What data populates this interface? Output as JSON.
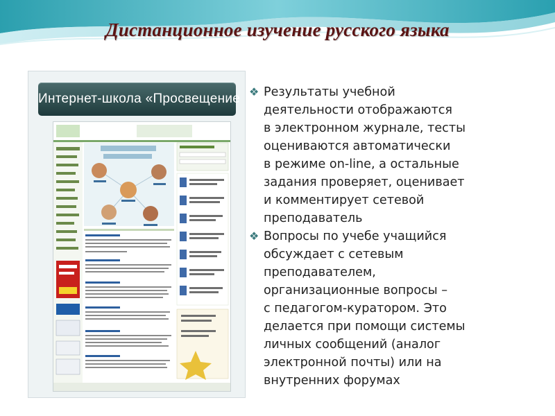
{
  "slide": {
    "title": "Дистанционное изучение русского языка"
  },
  "screenshot": {
    "banner_text": "Интернет-школа «Просвещение"
  },
  "bullets": [
    {
      "text": "Результаты  учебной\nдеятельности отображаются\nв электронном журнале, тесты\nоцениваются автоматически\nв режиме on-line, а остальные\nзадания проверяет, оценивает\nи комментирует сетевой\nпреподаватель"
    },
    {
      "text": "Вопросы по учебе учащийся\nобсуждает с сетевым\nпреподавателем,\nорганизационные вопросы –\nс педагогом-куратором. Это\nделается при помощи системы\nличных сообщений (аналог\nэлектронной почты) или на\nвнутренних форумах"
    }
  ],
  "colors": {
    "title": "#5a1414",
    "bullet": "#3b7a7d",
    "wave_main": "#2fa3b3",
    "banner": "#2e4b4c"
  },
  "icons": {
    "bullet": "diamond-bullet-icon"
  }
}
